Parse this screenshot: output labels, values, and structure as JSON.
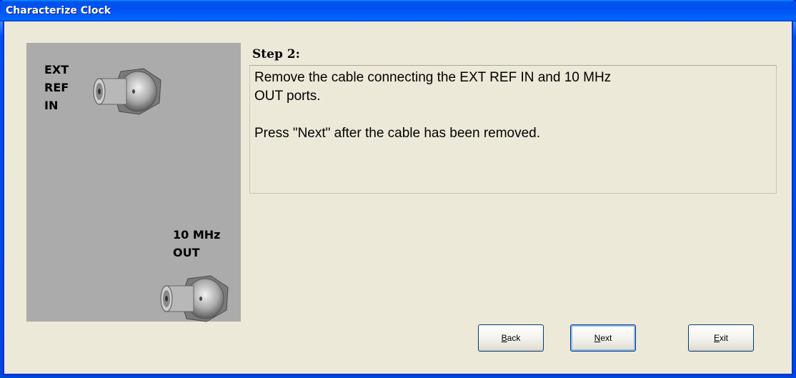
{
  "window": {
    "title": "Characterize Clock"
  },
  "connectors": {
    "ext_ref_label": "EXT\nREF\nIN",
    "out_label": "10 MHz\nOUT"
  },
  "step": {
    "title": "Step 2:",
    "line1": "Remove the cable connecting the EXT REF IN and 10 MHz",
    "line2": "OUT ports.",
    "line3": "Press \"Next\" after the cable has been removed."
  },
  "buttons": {
    "back_mnemonic": "B",
    "back_rest": "ack",
    "next_mnemonic": "N",
    "next_rest": "ext",
    "exit_mnemonic": "E",
    "exit_rest": "xit"
  },
  "colors": {
    "dialog_bg": "#ece9d8",
    "panel_bg": "#ababab",
    "titlebar_blue": "#0053ee",
    "button_border": "#003c74"
  }
}
